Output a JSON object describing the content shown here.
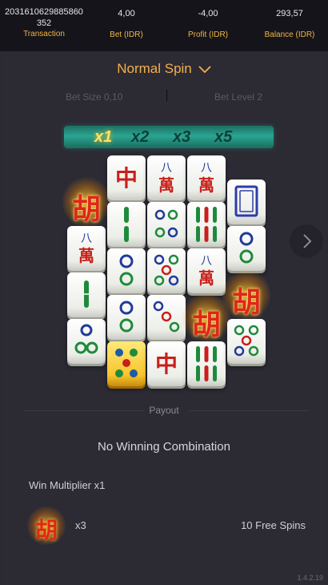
{
  "stats": {
    "transaction": {
      "value": "2031610629885860352",
      "label": "Transaction"
    },
    "bet": {
      "value": "4,00",
      "label": "Bet (IDR)"
    },
    "profit": {
      "value": "-4,00",
      "label": "Profit (IDR)"
    },
    "balance": {
      "value": "293,57",
      "label": "Balance (IDR)"
    }
  },
  "spin_mode": {
    "label": "Normal Spin"
  },
  "bet_size": {
    "label": "Bet Size 0,10"
  },
  "bet_level": {
    "label": "Bet Level 2"
  },
  "multipliers": [
    "x1",
    "x2",
    "x3",
    "x5"
  ],
  "active_multiplier": "x1",
  "wild_symbol": "胡",
  "payout": {
    "label": "Payout",
    "result": "No Winning Combination",
    "win_multiplier": "Win Multiplier x1",
    "scatter_count": "x3",
    "free_spins": "10 Free Spins"
  },
  "version": "1.4.2.19",
  "colors": {
    "accent": "#f4b04a",
    "multiplier_bar": "#2aa592",
    "background": "#2b2a33"
  }
}
